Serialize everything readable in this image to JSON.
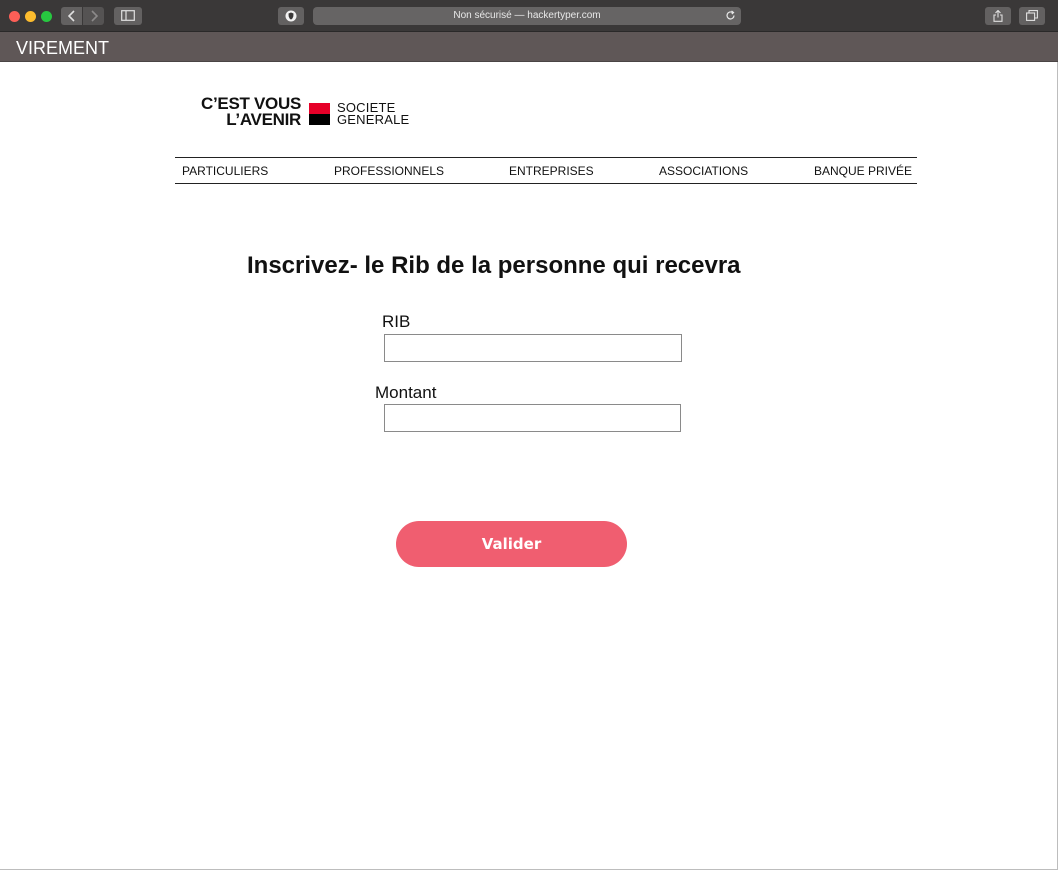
{
  "browser": {
    "address": "Non sécurisé — hackertyper.com",
    "tab_title": "VIREMENT",
    "icons": [
      "close-icon",
      "minimize-icon",
      "maximize-icon",
      "back-icon",
      "forward-icon",
      "sidebar-icon",
      "shield-icon",
      "reload-icon",
      "share-icon",
      "tabs-icon"
    ]
  },
  "logo": {
    "slogan_line1": "C’EST VOUS",
    "slogan_line2": "L’AVENIR",
    "brand_line1": "SOCIETE",
    "brand_line2": "GENERALE",
    "colors": {
      "red": "#e60028",
      "black": "#000000"
    }
  },
  "nav": {
    "items": [
      "PARTICULIERS",
      "PROFESSIONNELS",
      "ENTREPRISES",
      "ASSOCIATIONS",
      "BANQUE PRIVÉE"
    ]
  },
  "form": {
    "heading": "Inscrivez- le Rib de la personne qui recevra",
    "rib_label": "RIB",
    "rib_value": "",
    "amount_label": "Montant",
    "amount_value": "",
    "submit_label": "Valider",
    "accent": "#f05e70"
  }
}
